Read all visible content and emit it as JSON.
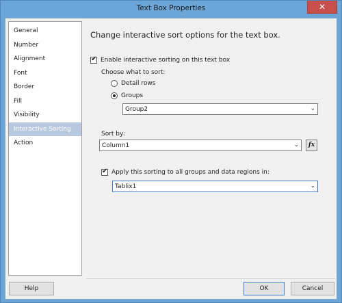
{
  "window": {
    "title": "Text Box Properties",
    "close_label": "✕"
  },
  "nav": {
    "items": [
      {
        "label": "General"
      },
      {
        "label": "Number"
      },
      {
        "label": "Alignment"
      },
      {
        "label": "Font"
      },
      {
        "label": "Border"
      },
      {
        "label": "Fill"
      },
      {
        "label": "Visibility"
      },
      {
        "label": "Interactive Sorting",
        "selected": true
      },
      {
        "label": "Action"
      }
    ]
  },
  "main": {
    "heading": "Change interactive sort options for the text box.",
    "enable_sort": {
      "label": "Enable interactive sorting on this text box",
      "checked": true
    },
    "choose_label": "Choose what to sort:",
    "radio_detail": {
      "label": "Detail rows",
      "selected": false
    },
    "radio_groups": {
      "label": "Groups",
      "selected": true
    },
    "group_select": {
      "value": "Group2"
    },
    "sort_by_label": "Sort by:",
    "sort_by_select": {
      "value": "Column1"
    },
    "fx_label": "fx",
    "apply_sort": {
      "label": "Apply this sorting to all groups and data regions in:",
      "checked": true
    },
    "region_select": {
      "value": "Tablix1"
    }
  },
  "footer": {
    "help_label": "Help",
    "ok_label": "OK",
    "cancel_label": "Cancel"
  }
}
